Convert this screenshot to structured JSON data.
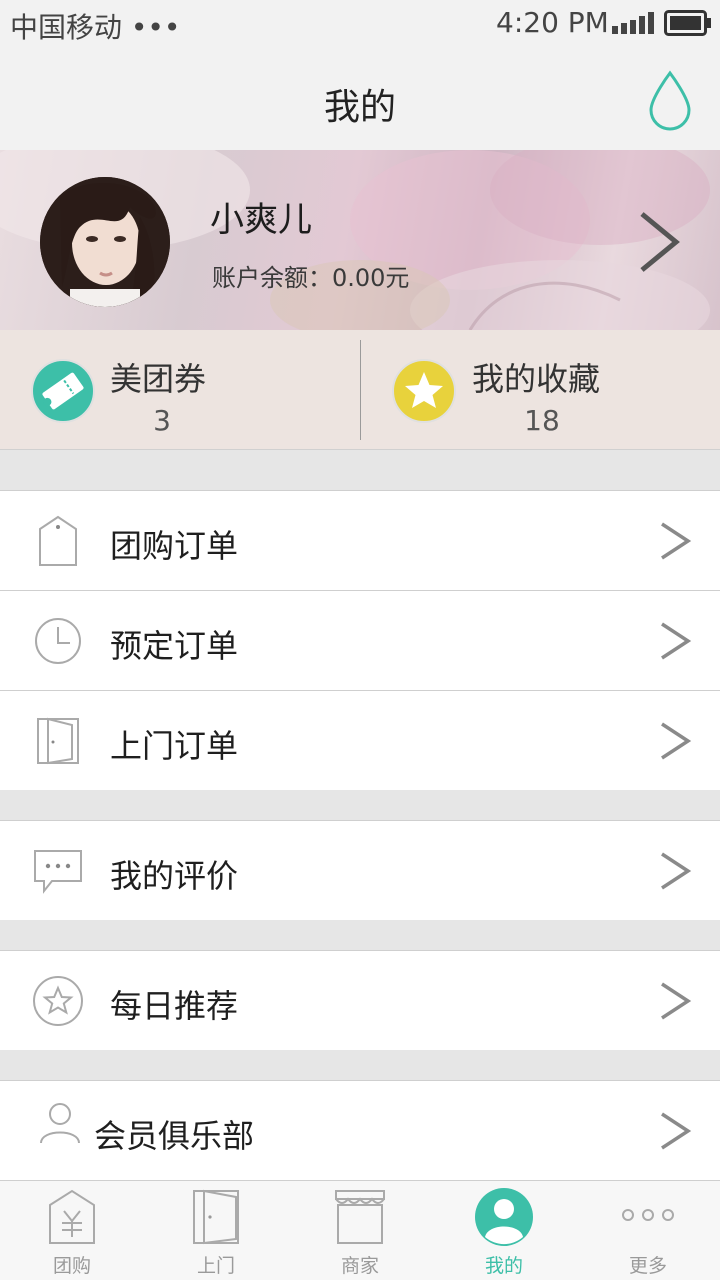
{
  "status_bar": {
    "carrier": "中国移动 •••",
    "time": "4:20 PM"
  },
  "header": {
    "title": "我的",
    "icon": "water-drop-icon"
  },
  "profile": {
    "name": "小爽儿",
    "balance": "账户余额：0.00元",
    "avatar": "user-avatar-photo"
  },
  "quick": [
    {
      "label": "美团券",
      "count": "3",
      "icon": "ticket-icon",
      "color": "#3dbfa8"
    },
    {
      "label": "我的收藏",
      "count": "18",
      "icon": "star-icon",
      "color": "#e8d23c"
    }
  ],
  "menu": [
    {
      "label": "团购订单",
      "icon": "tag-icon"
    },
    {
      "label": "预定订单",
      "icon": "clock-icon"
    },
    {
      "label": "上门订单",
      "icon": "door-icon"
    },
    {
      "label": "我的评价",
      "icon": "comment-icon"
    },
    {
      "label": "每日推荐",
      "icon": "star-outline-icon"
    },
    {
      "label": "会员俱乐部",
      "icon": "person-icon"
    }
  ],
  "tabs": [
    {
      "label": "团购",
      "icon": "yuan-tag-icon"
    },
    {
      "label": "上门",
      "icon": "door-icon"
    },
    {
      "label": "商家",
      "icon": "shop-icon"
    },
    {
      "label": "我的",
      "icon": "user-icon",
      "active": true
    },
    {
      "label": "更多",
      "icon": "more-dots-icon"
    }
  ],
  "colors": {
    "accent": "#3dbfa8",
    "star": "#e8d23c",
    "background": "#e6e6e6"
  }
}
